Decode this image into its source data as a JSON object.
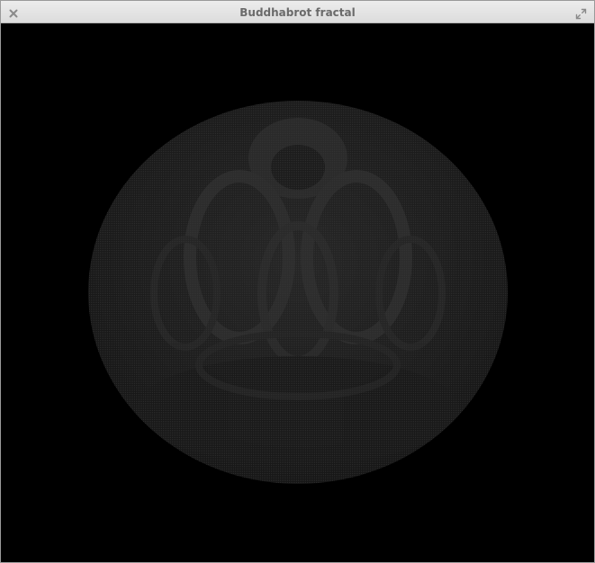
{
  "window": {
    "title": "Buddhabrot fractal"
  },
  "icons": {
    "close": "close-icon",
    "maximize": "maximize-icon"
  },
  "colors": {
    "background": "#000000",
    "fractal_glow": "#2a2a2a",
    "titlebar": "#e3e3e3",
    "title_text": "#6a6a6a"
  }
}
